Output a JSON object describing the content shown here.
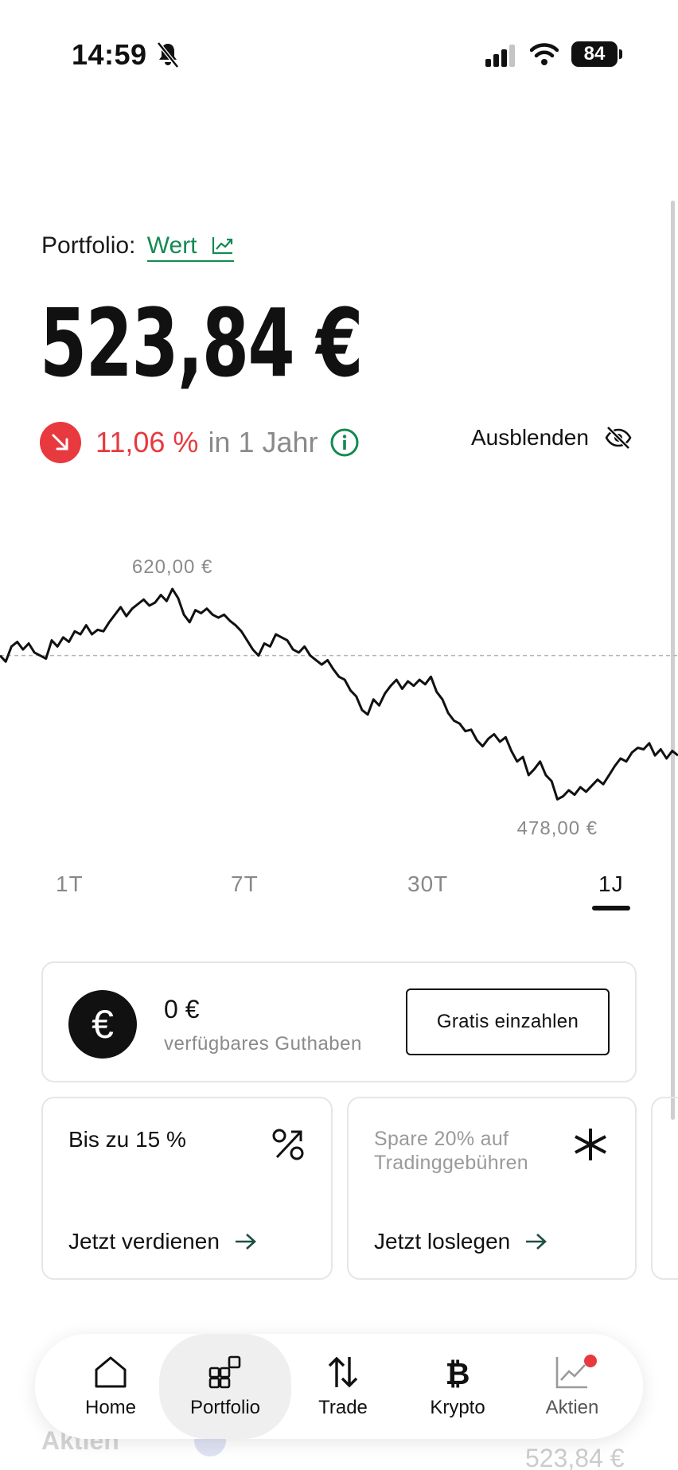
{
  "status_bar": {
    "time": "14:59",
    "battery": "84"
  },
  "header": {
    "portfolio_label": "Portfolio:",
    "portfolio_link": "Wert",
    "total_value": "523,84 €",
    "change_percent": "11,06 %",
    "change_period": "in 1 Jahr",
    "hide_label": "Ausblenden"
  },
  "chart_data": {
    "type": "line",
    "max_label": "620,00 €",
    "min_label": "478,00 €",
    "max": 620,
    "min": 478,
    "reference": 576,
    "values": [
      576,
      572,
      582,
      585,
      580,
      584,
      578,
      576,
      574,
      586,
      582,
      588,
      585,
      592,
      590,
      596,
      590,
      593,
      592,
      598,
      603,
      608,
      602,
      607,
      610,
      613,
      609,
      611,
      616,
      612,
      620,
      614,
      603,
      598,
      606,
      604,
      607,
      603,
      601,
      603,
      599,
      596,
      592,
      586,
      580,
      576,
      584,
      582,
      590,
      588,
      586,
      580,
      578,
      582,
      576,
      573,
      570,
      573,
      567,
      562,
      560,
      553,
      549,
      540,
      537,
      547,
      543,
      551,
      556,
      560,
      554,
      559,
      556,
      560,
      557,
      562,
      552,
      547,
      538,
      533,
      531,
      526,
      527,
      520,
      516,
      521,
      524,
      519,
      522,
      513,
      506,
      509,
      497,
      501,
      506,
      497,
      493,
      481,
      483,
      487,
      484,
      489,
      486,
      490,
      494,
      491,
      497,
      503,
      508,
      506,
      512,
      515,
      514,
      518,
      510,
      514,
      508,
      513,
      510
    ]
  },
  "range_tabs": [
    "1T",
    "7T",
    "30T",
    "1J"
  ],
  "range_active": "1J",
  "balance": {
    "amount": "0 €",
    "label": "verfügbares Guthaben",
    "button": "Gratis einzahlen"
  },
  "promos": [
    {
      "title": "Bis zu 15 %",
      "cta": "Jetzt verdienen",
      "icon": "percent-icon"
    },
    {
      "title": "Spare 20% auf Tradinggebühren",
      "cta": "Jetzt loslegen",
      "icon": "asterisk-icon"
    }
  ],
  "background_section": {
    "stocks_label": "Aktien",
    "stocks_value": "523,84 €"
  },
  "bottom_nav": [
    {
      "label": "Home",
      "icon": "home-icon"
    },
    {
      "label": "Portfolio",
      "icon": "portfolio-icon"
    },
    {
      "label": "Trade",
      "icon": "trade-icon"
    },
    {
      "label": "Krypto",
      "icon": "bitcoin-icon"
    },
    {
      "label": "Aktien",
      "icon": "stocks-icon"
    }
  ],
  "colors": {
    "accent_green": "#138a52",
    "negative_red": "#e8393f",
    "text_dark": "#111111",
    "text_muted": "#8a8a8a"
  }
}
